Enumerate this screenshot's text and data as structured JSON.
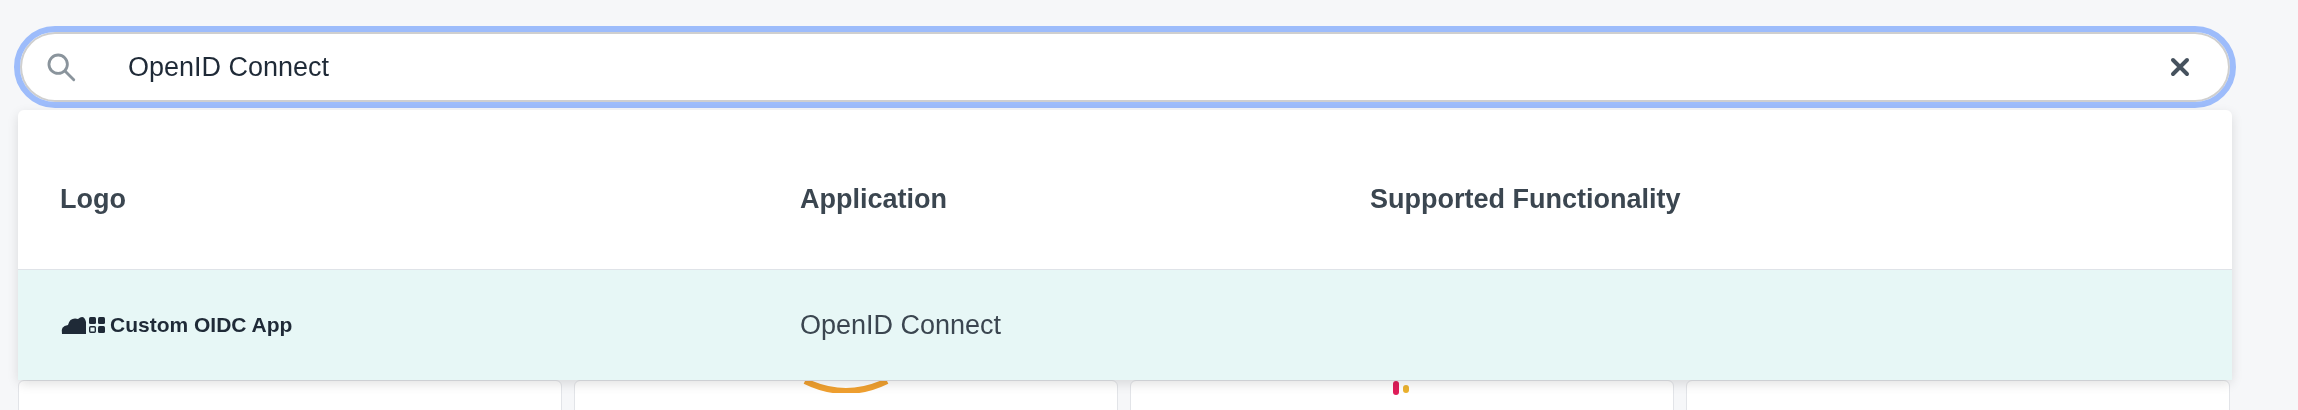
{
  "search": {
    "value": "OpenID Connect"
  },
  "results": {
    "columns": [
      "Logo",
      "Application",
      "Supported Functionality"
    ],
    "rows": [
      {
        "logo_text": "Custom OIDC App",
        "application": "OpenID Connect",
        "selected": true
      }
    ]
  }
}
